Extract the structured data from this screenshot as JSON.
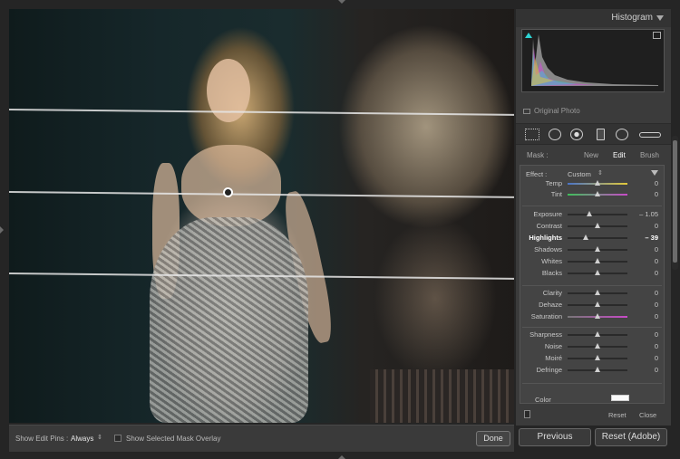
{
  "histogram": {
    "title": "Histogram",
    "original_photo_label": "Original Photo"
  },
  "mask": {
    "label": "Mask :",
    "options": [
      "New",
      "Edit",
      "Brush"
    ]
  },
  "effect": {
    "label": "Effect :",
    "value": "Custom"
  },
  "adjustments": [
    {
      "label": "Temp",
      "value": "0",
      "pos": 0.5
    },
    {
      "label": "Tint",
      "value": "0",
      "pos": 0.5
    },
    {
      "label": "Exposure",
      "value": "– 1.05",
      "pos": 0.36
    },
    {
      "label": "Contrast",
      "value": "0",
      "pos": 0.5
    },
    {
      "label": "Highlights",
      "value": "– 39",
      "pos": 0.3,
      "active": true
    },
    {
      "label": "Shadows",
      "value": "0",
      "pos": 0.5
    },
    {
      "label": "Whites",
      "value": "0",
      "pos": 0.5
    },
    {
      "label": "Blacks",
      "value": "0",
      "pos": 0.5
    },
    {
      "label": "Clarity",
      "value": "0",
      "pos": 0.5
    },
    {
      "label": "Dehaze",
      "value": "0",
      "pos": 0.5
    },
    {
      "label": "Saturation",
      "value": "0",
      "pos": 0.5
    },
    {
      "label": "Sharpness",
      "value": "0",
      "pos": 0.5
    },
    {
      "label": "Noise",
      "value": "0",
      "pos": 0.5
    },
    {
      "label": "Moiré",
      "value": "0",
      "pos": 0.5
    },
    {
      "label": "Defringe",
      "value": "0",
      "pos": 0.5
    }
  ],
  "color_label": "Color",
  "footer": {
    "reset": "Reset",
    "close": "Close"
  },
  "toolbar": {
    "show_edit_pins_label": "Show Edit Pins :",
    "show_edit_pins_value": "Always",
    "mask_overlay_label": "Show Selected Mask Overlay",
    "done": "Done"
  },
  "buttons": {
    "previous": "Previous",
    "reset_adobe": "Reset (Adobe)"
  },
  "colors": {
    "clip_indicator": "#2ed3d3",
    "panel_bg": "#3b3b3b"
  }
}
